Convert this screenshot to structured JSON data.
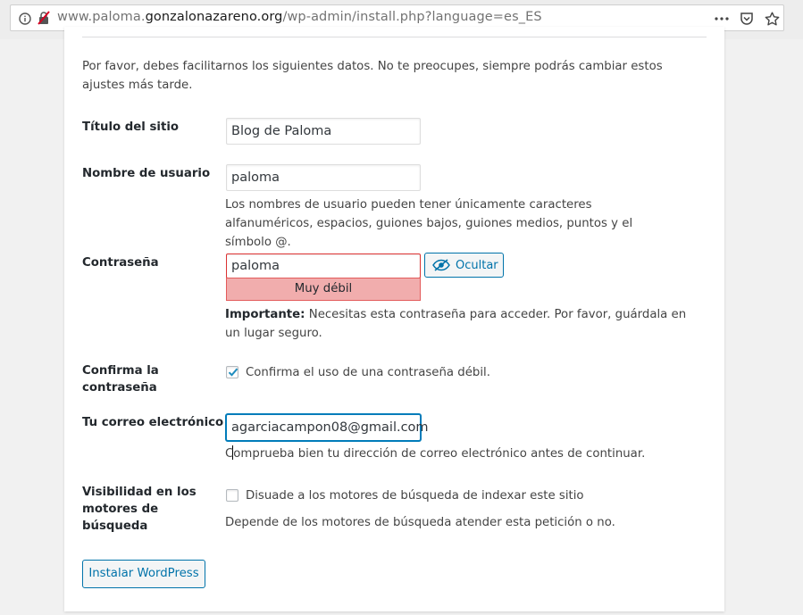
{
  "browser": {
    "url_prefix": "www.paloma.",
    "url_domain": "gonzalonazareno.org",
    "url_path": "/wp-admin/install.php?language=es_ES"
  },
  "intro": "Por favor, debes facilitarnos los siguientes datos. No te preocupes, siempre podrás cambiar estos ajustes más tarde.",
  "form": {
    "site_title": {
      "label": "Título del sitio",
      "value": "Blog de Paloma"
    },
    "username": {
      "label": "Nombre de usuario",
      "value": "paloma",
      "description": "Los nombres de usuario pueden tener únicamente caracteres alfanuméricos, espacios, guiones bajos, guiones medios, puntos y el símbolo @."
    },
    "password": {
      "label": "Contraseña",
      "value": "paloma",
      "strength": "Muy débil",
      "hide_label": "Ocultar",
      "important_bold": "Importante:",
      "important_text": " Necesitas esta contraseña para acceder. Por favor, guárdala en un lugar seguro."
    },
    "confirm": {
      "label": "Confirma la contraseña",
      "checkbox_label": "Confirma el uso de una contraseña débil.",
      "checked": true
    },
    "email": {
      "label": "Tu correo electrónico",
      "value": "agarciacampon08@gmail.com",
      "description": "Comprueba bien tu dirección de correo electrónico antes de continuar."
    },
    "visibility": {
      "label": "Visibilidad en los motores de búsqueda",
      "checkbox_label": "Disuade a los motores de búsqueda de indexar este sitio",
      "checked": false,
      "description": "Depende de los motores de búsqueda atender esta petición o no."
    },
    "submit_label": "Instalar WordPress"
  },
  "colors": {
    "accent": "#0073aa",
    "error_border": "#dc3232",
    "strength_bg": "#f1adad"
  }
}
